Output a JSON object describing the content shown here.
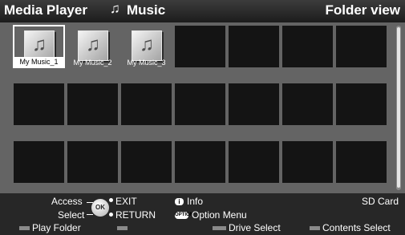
{
  "header": {
    "app_title": "Media Player",
    "category_icon": "music-note-icon",
    "category": "Music",
    "view_mode": "Folder view"
  },
  "grid": {
    "columns": 7,
    "rows": 3,
    "selected_index": 0,
    "folders": [
      {
        "label": "My Music_1",
        "icon": "music-folder-icon"
      },
      {
        "label": "My Music_2",
        "icon": "music-folder-icon"
      },
      {
        "label": "My Music_3",
        "icon": "music-folder-icon"
      }
    ]
  },
  "footer": {
    "access_label": "Access",
    "select_label": "Select",
    "exit_label": "EXIT",
    "return_label": "RETURN",
    "info_label": "Info",
    "info_icon_text": "i",
    "option_menu_label": "Option Menu",
    "option_icon_text": "OPTION",
    "device_label": "SD Card",
    "play_folder_label": "Play Folder",
    "drive_select_label": "Drive Select",
    "contents_select_label": "Contents Select"
  },
  "colors": {
    "grid_background": "#646464",
    "empty_cell": "#141414",
    "footer_background": "#272727",
    "color_key_swatch": "#8a8a8a"
  }
}
